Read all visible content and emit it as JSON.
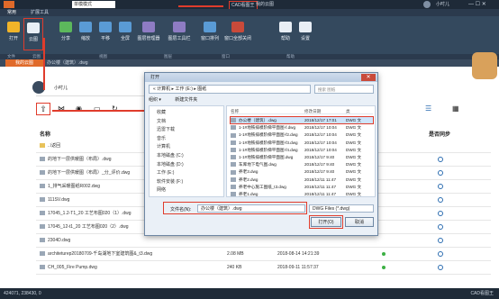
{
  "titlebar": {
    "mode": "单模模式",
    "app_title": "CAD看图王",
    "doc_title": "我的云图",
    "user": "小吋儿"
  },
  "ribbon_tabs": [
    "常用",
    "扩展工具"
  ],
  "ribbon_buttons": [
    "打开",
    "云图",
    "分享",
    "缩放",
    "平移",
    "全屏",
    "图层管理器",
    "图层工具栏",
    "窗口排列",
    "窗口全部关闭",
    "帮助",
    "设置"
  ],
  "ribbon_groups": [
    "文件",
    "云图",
    "视图",
    "图层",
    "窗口",
    "帮助"
  ],
  "tab": {
    "label": "我的云图"
  },
  "file_tab": "办公楼（建筑）.dwg",
  "panel": {
    "username": "小吋儿",
    "col_name": "名称",
    "col_sync": "是否同步",
    "files": [
      {
        "name": "..\\返回",
        "size": "",
        "date": "",
        "type": "back"
      },
      {
        "name": "的地下一层供暖图（布局）.dwg",
        "size": "",
        "date": ""
      },
      {
        "name": "的地下一层供暖图（布局）_分_评价.dwg",
        "size": "",
        "date": ""
      },
      {
        "name": "1_排气采暖图纸R002.dwg",
        "size": "",
        "date": ""
      },
      {
        "name": "111SV.dwg",
        "size": "",
        "date": ""
      },
      {
        "name": "17045_1.2-T1_20 工艺布图020（1）.dwg",
        "size": "",
        "date": ""
      },
      {
        "name": "17045_12-t1_20 工艺布图020（2）.dwg",
        "size": "",
        "date": ""
      },
      {
        "name": "2304D.dwg",
        "size": "",
        "date": ""
      },
      {
        "name": "architeturep20180709-千岛湖地下室建筑图&_t3.dwg",
        "size": "2.08 MB",
        "date": "2018-08-14 14:21:39"
      },
      {
        "name": "CH_005_Fire Pump.dwg",
        "size": "240 KB",
        "date": "2018-09-11 11:57:37"
      }
    ]
  },
  "dialog": {
    "title": "打开",
    "path": "« 计算机 ▸ 工作 (E:) ▸ 图纸",
    "search_placeholder": "搜索 图纸",
    "organize": "组织 ▾",
    "new_folder": "新建文件夹",
    "nav": [
      "收藏",
      "文档",
      "迅雷下载",
      "音乐",
      "计算机",
      "本地磁盘 (C:)",
      "本地磁盘 (D:)",
      "工作 (E:)",
      "软件安装 (F:)",
      "网络"
    ],
    "col_name": "名称",
    "col_date": "修改日期",
    "col_type": "类",
    "files": [
      {
        "name": "办公楼（建筑）.dwg",
        "date": "2018/12/17 17:01",
        "type": "DWG 文",
        "selected": true
      },
      {
        "name": "1-1#地铁排模阶梯平面图-f.dwg",
        "date": "2018/12/17 10:04",
        "type": "DWG 文"
      },
      {
        "name": "1-1#地铁排模阶梯平面图-f2.dwg",
        "date": "2018/12/17 10:04",
        "type": "DWG 文"
      },
      {
        "name": "1-1#地铁排模阶梯平面图-f3.dwg",
        "date": "2018/12/17 10:04",
        "type": "DWG 文"
      },
      {
        "name": "1-1#地铁排模阶梯平面图-f4.dwg",
        "date": "2018/12/17 10:04",
        "type": "DWG 文"
      },
      {
        "name": "1-1#地铁排模阶梯平面图.dwg",
        "date": "2018/12/17 9:40",
        "type": "DWG 文"
      },
      {
        "name": "车库地下电气图.dwg",
        "date": "2018/12/17 9:40",
        "type": "DWG 文"
      },
      {
        "name": "养老3.dwg",
        "date": "2018/12/17 9:40",
        "type": "DWG 文"
      },
      {
        "name": "养老2.dwg",
        "date": "2018/12/11 11:47",
        "type": "DWG 文"
      },
      {
        "name": "养老中心施工图纸_t3.dwg",
        "date": "2018/12/11 11:47",
        "type": "DWG 文"
      },
      {
        "name": "养老1.dwg",
        "date": "2018/12/11 11:47",
        "type": "DWG 文"
      }
    ],
    "filename_label": "文件名(N):",
    "filename_value": "办公楼（建筑）.dwg",
    "filter": "DWG Files (*.dwg)",
    "open_label": "打开(O)",
    "cancel_label": "取消"
  },
  "status": {
    "coords": "424071, 238430, 0",
    "app": "CAD看图王"
  }
}
